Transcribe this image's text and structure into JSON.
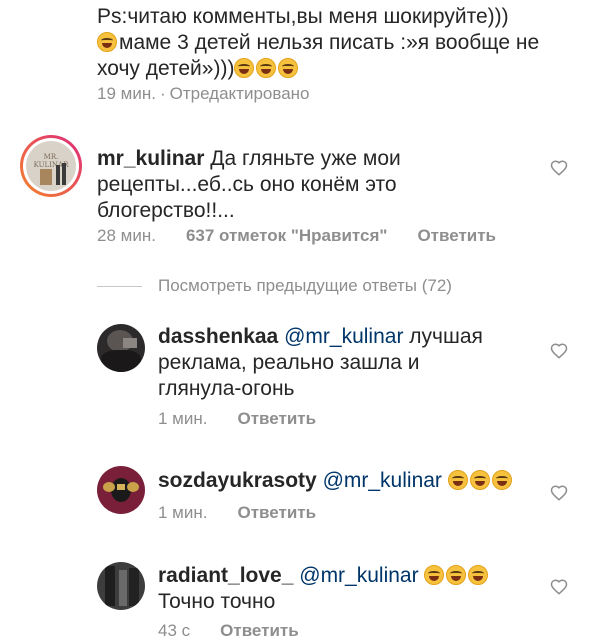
{
  "top_comment": {
    "line1": "Ps:читаю комменты,вы меня шокируйте)))",
    "line2_text": "маме 3 детей нельзя писать :»я вообще не",
    "line3_text": "хочу детей»)))",
    "time": "19 мин.",
    "sep": "·",
    "edited": "Отредактировано"
  },
  "main_comment": {
    "username": "mr_kulinar",
    "text_line1": "Да гляньте уже мои",
    "text_line2": "рецепты...еб..сь оно конём это",
    "text_line3": "блогерство!!...",
    "time": "28 мин.",
    "likes": "637 отметок \"Нравится\"",
    "reply": "Ответить",
    "avatar_text": "MR. KULINAR"
  },
  "view_previous": "Посмотреть предыдущие ответы (72)",
  "replies": [
    {
      "username": "dasshenkaa",
      "mention": "@mr_kulinar",
      "text_line1": "лучшая",
      "text_line2": "реклама, реально зашла и",
      "text_line3": "глянула-огонь",
      "time": "1 мин.",
      "reply": "Ответить"
    },
    {
      "username": "sozdayukrasoty",
      "mention": "@mr_kulinar",
      "time": "1 мин.",
      "reply": "Ответить"
    },
    {
      "username": "radiant_love_",
      "mention": "@mr_kulinar",
      "text_line2": "Точно точно",
      "time": "43 с",
      "reply": "Ответить"
    }
  ],
  "colors": {
    "text": "#262626",
    "meta": "#8e8e8e",
    "mention": "#003569",
    "ring_start": "#f58529",
    "ring_end": "#dd2a7b"
  }
}
